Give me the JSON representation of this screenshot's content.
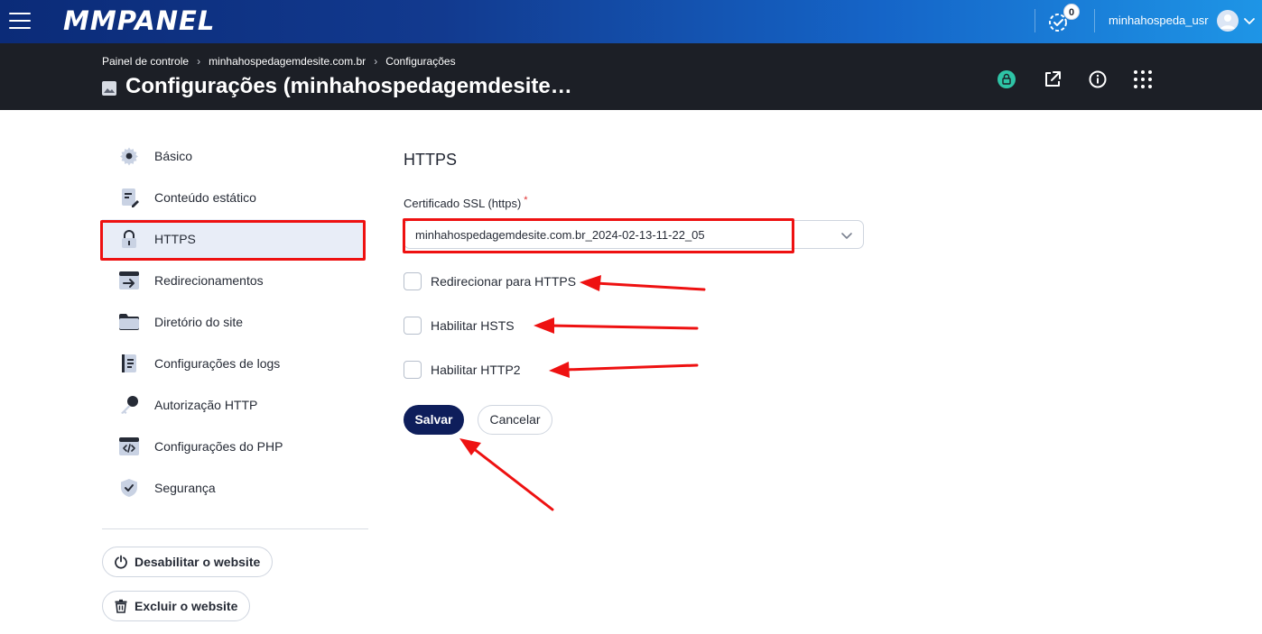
{
  "topbar": {
    "logo": "MMPANEL",
    "task_count": "0",
    "username": "minhahospeda_usr"
  },
  "header": {
    "breadcrumb": [
      "Painel de controle",
      "minhahospedagemdesite.com.br",
      "Configurações"
    ],
    "title": "Configurações (minhahospedagemdesite…"
  },
  "sidebar": {
    "items": [
      {
        "label": "Básico",
        "icon": "gear-icon"
      },
      {
        "label": "Conteúdo estático",
        "icon": "file-edit-icon"
      },
      {
        "label": "HTTPS",
        "icon": "lock-icon",
        "active": true
      },
      {
        "label": "Redirecionamentos",
        "icon": "redirect-icon"
      },
      {
        "label": "Diretório do site",
        "icon": "folder-icon"
      },
      {
        "label": "Configurações de logs",
        "icon": "log-book-icon"
      },
      {
        "label": "Autorização HTTP",
        "icon": "key-icon"
      },
      {
        "label": "Configurações do PHP",
        "icon": "code-window-icon"
      },
      {
        "label": "Segurança",
        "icon": "shield-check-icon"
      }
    ],
    "disable_label": "Desabilitar o website",
    "delete_label": "Excluir o website"
  },
  "main": {
    "section_title": "HTTPS",
    "ssl_label": "Certificado SSL (https)",
    "required_mark": "*",
    "ssl_value": "minhahospedagemdesite.com.br_2024-02-13-11-22_05",
    "checkboxes": [
      {
        "label": "Redirecionar para HTTPS",
        "checked": false
      },
      {
        "label": "Habilitar HSTS",
        "checked": false
      },
      {
        "label": "Habilitar HTTP2",
        "checked": false
      }
    ],
    "save_label": "Salvar",
    "cancel_label": "Cancelar"
  },
  "colors": {
    "primary_button": "#0e1e5b",
    "annotation_red": "#ee1111",
    "header_dark": "#1c1f26",
    "ssl_badge": "#2ec4a6"
  }
}
